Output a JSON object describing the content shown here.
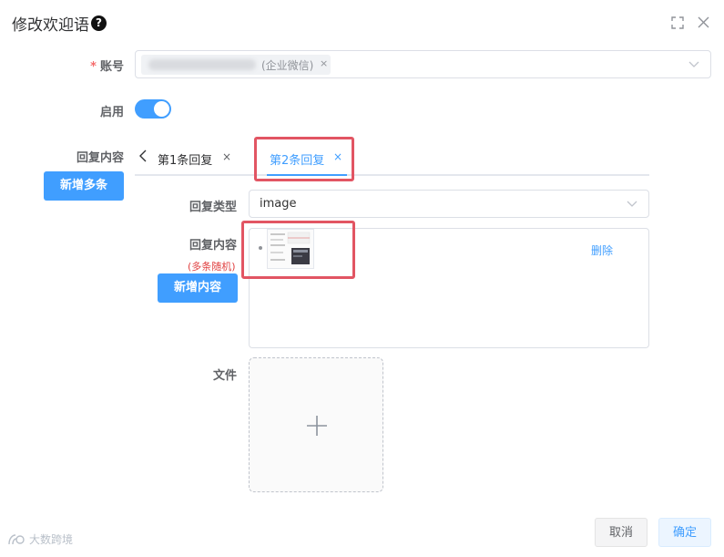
{
  "dialog": {
    "title": "修改欢迎语",
    "help_icon": "question-circle-icon",
    "fullscreen_icon": "fullscreen-icon",
    "close_icon": "close-icon"
  },
  "account": {
    "label": "账号",
    "required_mark": "*",
    "tag_suffix": "(企业微信)",
    "tag_close": "×",
    "chevron": "chevron-down-icon"
  },
  "enable": {
    "label": "启用",
    "checked": true
  },
  "reply_content": {
    "label": "回复内容",
    "add_multiple_button": "新增多条",
    "tabs": [
      {
        "label": "第1条回复",
        "close": "×",
        "active": false
      },
      {
        "label": "第2条回复",
        "close": "×",
        "active": true
      }
    ],
    "reply_type_label": "回复类型",
    "reply_type_value": "image",
    "inner_label": "回复内容",
    "inner_sublabel": "(多条随机)",
    "add_content_button": "新增内容",
    "delete_link": "删除",
    "file_label": "文件",
    "upload_icon": "plus-icon"
  },
  "footer": {
    "cancel_label": "取消",
    "ok_label": "确定"
  },
  "watermark": {
    "text": "大数跨境"
  },
  "colors": {
    "primary": "#409eff",
    "highlight": "#e25563",
    "danger": "#e04040"
  }
}
